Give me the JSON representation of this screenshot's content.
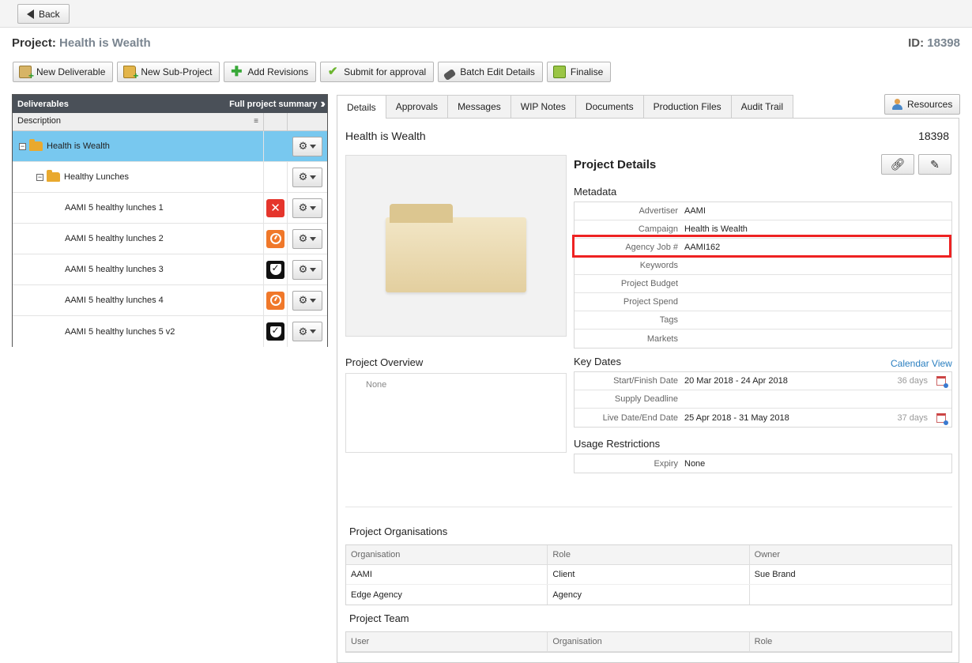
{
  "top": {
    "back_label": "Back"
  },
  "project": {
    "title_label": "Project:",
    "title_value": "Health is Wealth",
    "id_label": "ID:",
    "id_value": "18398"
  },
  "toolbar": {
    "new_deliverable": "New Deliverable",
    "new_subproject": "New Sub-Project",
    "add_revisions": "Add Revisions",
    "submit_approval": "Submit for approval",
    "batch_edit": "Batch Edit Details",
    "finalise": "Finalise"
  },
  "deliverables": {
    "header": "Deliverables",
    "summary_link": "Full project summary",
    "col_description": "Description",
    "rows": [
      {
        "label": "Health is Wealth",
        "status": ""
      },
      {
        "label": "Healthy Lunches",
        "status": ""
      },
      {
        "label": "AAMI 5 healthy lunches 1",
        "status": "rejected"
      },
      {
        "label": "AAMI 5 healthy lunches 2",
        "status": "in-progress"
      },
      {
        "label": "AAMI 5 healthy lunches 3",
        "status": "approved"
      },
      {
        "label": "AAMI 5 healthy lunches 4",
        "status": "in-progress"
      },
      {
        "label": "AAMI 5 healthy lunches 5 v2",
        "status": "approved"
      }
    ]
  },
  "tabs": [
    "Details",
    "Approvals",
    "Messages",
    "WIP Notes",
    "Documents",
    "Production Files",
    "Audit Trail"
  ],
  "resources_label": "Resources",
  "details": {
    "title": "Health is Wealth",
    "id": "18398",
    "project_details_heading": "Project Details",
    "metadata_heading": "Metadata",
    "metadata": [
      {
        "k": "Advertiser",
        "v": "AAMI"
      },
      {
        "k": "Campaign",
        "v": "Health is Wealth"
      },
      {
        "k": "Agency Job #",
        "v": "AAMI162"
      },
      {
        "k": "Keywords",
        "v": ""
      },
      {
        "k": "Project Budget",
        "v": ""
      },
      {
        "k": "Project Spend",
        "v": ""
      },
      {
        "k": "Tags",
        "v": ""
      },
      {
        "k": "Markets",
        "v": ""
      }
    ],
    "overview_heading": "Project Overview",
    "overview_value": "None",
    "key_dates_heading": "Key Dates",
    "calendar_view": "Calendar View",
    "key_dates": [
      {
        "k": "Start/Finish Date",
        "v": "20 Mar 2018 - 24 Apr 2018",
        "days": "36 days"
      },
      {
        "k": "Supply Deadline",
        "v": "",
        "days": ""
      },
      {
        "k": "Live Date/End Date",
        "v": "25 Apr 2018 - 31 May 2018",
        "days": "37 days"
      }
    ],
    "usage_heading": "Usage Restrictions",
    "usage": [
      {
        "k": "Expiry",
        "v": "None"
      }
    ],
    "orgs_heading": "Project Organisations",
    "orgs_cols": [
      "Organisation",
      "Role",
      "Owner"
    ],
    "orgs_rows": [
      [
        "AAMI",
        "Client",
        "Sue Brand"
      ],
      [
        "Edge Agency",
        "Agency",
        ""
      ]
    ],
    "team_heading": "Project Team",
    "team_cols": [
      "User",
      "Organisation",
      "Role"
    ]
  },
  "colors": {
    "selected_row": "#78c8ef",
    "header_dark": "#4a5058",
    "highlight": "#ee2222",
    "link": "#2a7fc0"
  }
}
